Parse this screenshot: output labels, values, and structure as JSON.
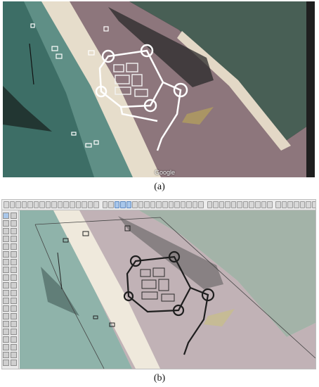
{
  "panel_a": {
    "caption": "(a)",
    "map_credit": "Google"
  },
  "panel_b": {
    "caption": "(b)",
    "toolbar": {
      "buttons": [
        "select",
        "paint",
        "eraser",
        "line",
        "arc",
        "rectangle",
        "circle",
        "polygon",
        "push-pull",
        "move",
        "rotate",
        "scale",
        "offset",
        "tape",
        "text",
        "dimension",
        "orbit",
        "pan",
        "zoom",
        "zoom-extents",
        "prev-view",
        "next-view",
        "iso",
        "top",
        "front",
        "right",
        "back",
        "left",
        "bottom",
        "xray",
        "wireframe",
        "hidden-line",
        "shaded",
        "textured",
        "monochrome",
        "sandbox",
        "geo-location",
        "add-location",
        "toggle-terrain",
        "photo-texture",
        "3d-warehouse",
        "share-model",
        "extension-warehouse",
        "layout",
        "style-1",
        "style-2",
        "style-3",
        "style-4",
        "style-5",
        "style-6",
        "style-7"
      ],
      "active": [
        "zoom",
        "zoom-extents",
        "prev-view"
      ]
    },
    "palette": {
      "button_count": 40,
      "active_index": 0
    }
  },
  "colors": {
    "sea": "#5f8f86",
    "sea_deep": "#3b6a63",
    "lagoon": "#466358",
    "sand": "#e9e1cf",
    "land": "#8a7379",
    "model_line": "#ffffff"
  }
}
